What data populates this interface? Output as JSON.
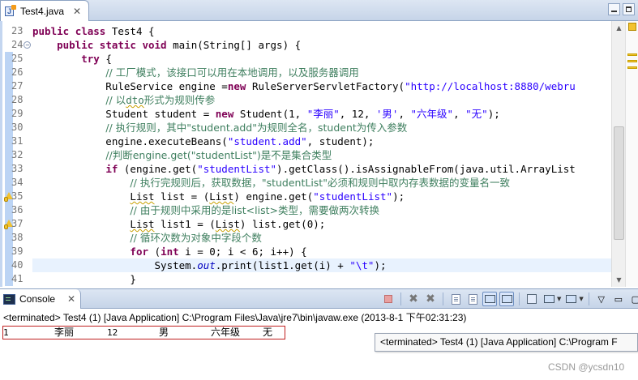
{
  "editor_tab": {
    "title": "Test4.java",
    "close": "✕"
  },
  "code_lines": [
    {
      "n": "23",
      "tokens": [
        {
          "t": "public ",
          "c": "kw"
        },
        {
          "t": "class ",
          "c": "kw"
        },
        {
          "t": "Test4 {"
        }
      ]
    },
    {
      "n": "24",
      "fold": "−",
      "tokens": [
        {
          "t": "    "
        },
        {
          "t": "public ",
          "c": "kw"
        },
        {
          "t": "static ",
          "c": "kw"
        },
        {
          "t": "void ",
          "c": "kw"
        },
        {
          "t": "main(String[] args) {"
        }
      ]
    },
    {
      "n": "25",
      "tokens": [
        {
          "t": "        "
        },
        {
          "t": "try ",
          "c": "kw"
        },
        {
          "t": "{"
        }
      ]
    },
    {
      "n": "26",
      "tokens": [
        {
          "t": "            "
        },
        {
          "t": "// 工厂模式，该接口可以用在本地调用，以及服务器调用",
          "c": "cm cjk"
        }
      ]
    },
    {
      "n": "27",
      "tokens": [
        {
          "t": "            RuleService engine ="
        },
        {
          "t": "new ",
          "c": "kw"
        },
        {
          "t": "RuleServerServletFactory("
        },
        {
          "t": "\"http://localhost:8880/webru",
          "c": "str"
        }
      ]
    },
    {
      "n": "28",
      "tokens": [
        {
          "t": "            "
        },
        {
          "t": "// 以",
          "c": "cm cjk"
        },
        {
          "t": "dto",
          "c": "cm squig"
        },
        {
          "t": "形式为规则传参",
          "c": "cm cjk"
        }
      ]
    },
    {
      "n": "29",
      "tokens": [
        {
          "t": "            Student student = "
        },
        {
          "t": "new ",
          "c": "kw"
        },
        {
          "t": "Student(1, "
        },
        {
          "t": "\"李丽\"",
          "c": "str"
        },
        {
          "t": ", 12, "
        },
        {
          "t": "'男'",
          "c": "str"
        },
        {
          "t": ", "
        },
        {
          "t": "\"六年级\"",
          "c": "str"
        },
        {
          "t": ", "
        },
        {
          "t": "\"无\"",
          "c": "str"
        },
        {
          "t": ");"
        }
      ]
    },
    {
      "n": "30",
      "tokens": [
        {
          "t": "            "
        },
        {
          "t": "// 执行规则，其中\"student.add\"为规则全名，student为传入参数",
          "c": "cm cjk"
        }
      ]
    },
    {
      "n": "31",
      "tokens": [
        {
          "t": "            engine.executeBeans("
        },
        {
          "t": "\"student.add\"",
          "c": "str"
        },
        {
          "t": ", student);"
        }
      ]
    },
    {
      "n": "32",
      "tokens": [
        {
          "t": "            "
        },
        {
          "t": "//判断engine.get(\"studentList\")是不是集合类型",
          "c": "cm cjk"
        }
      ]
    },
    {
      "n": "33",
      "tokens": [
        {
          "t": "            "
        },
        {
          "t": "if ",
          "c": "kw"
        },
        {
          "t": "(engine.get("
        },
        {
          "t": "\"studentList\"",
          "c": "str"
        },
        {
          "t": ").getClass().isAssignableFrom(java.util.ArrayList"
        }
      ]
    },
    {
      "n": "34",
      "tokens": [
        {
          "t": "                "
        },
        {
          "t": "// 执行完规则后，获取数据，\"studentList\"必须和规则中取内存表数据的变量名一致",
          "c": "cm cjk"
        }
      ]
    },
    {
      "n": "35",
      "warn": true,
      "tokens": [
        {
          "t": "                "
        },
        {
          "t": "List",
          "c": "squig"
        },
        {
          "t": " list = ("
        },
        {
          "t": "List",
          "c": "squig"
        },
        {
          "t": ") engine.get("
        },
        {
          "t": "\"studentList\"",
          "c": "str"
        },
        {
          "t": ");"
        }
      ]
    },
    {
      "n": "36",
      "tokens": [
        {
          "t": "                "
        },
        {
          "t": "// 由于规则中采用的是list<list>类型，需要做两次转换",
          "c": "cm cjk"
        }
      ]
    },
    {
      "n": "37",
      "warn": true,
      "tokens": [
        {
          "t": "                "
        },
        {
          "t": "List",
          "c": "squig"
        },
        {
          "t": " list1 = ("
        },
        {
          "t": "List",
          "c": "squig"
        },
        {
          "t": ") list.get(0);"
        }
      ]
    },
    {
      "n": "38",
      "tokens": [
        {
          "t": "                "
        },
        {
          "t": "// 循环次数为对象中字段个数",
          "c": "cm cjk"
        }
      ]
    },
    {
      "n": "39",
      "tokens": [
        {
          "t": "                "
        },
        {
          "t": "for ",
          "c": "kw"
        },
        {
          "t": "("
        },
        {
          "t": "int ",
          "c": "kw"
        },
        {
          "t": "i = 0; i < 6; i++) {"
        }
      ]
    },
    {
      "n": "40",
      "current": true,
      "tokens": [
        {
          "t": "                    System."
        },
        {
          "t": "out",
          "c": "fld"
        },
        {
          "t": ".print(list1.get(i) + "
        },
        {
          "t": "\"\\t\"",
          "c": "str"
        },
        {
          "t": ");"
        }
      ]
    },
    {
      "n": "41",
      "tokens": [
        {
          "t": "                }"
        }
      ]
    }
  ],
  "console": {
    "tab_label": "Console",
    "close": "✕",
    "status": "<terminated> Test4 (1) [Java Application] C:\\Program Files\\Java\\jre7\\bin\\javaw.exe (2013-8-1 下午02:31:23)",
    "output": [
      "1",
      "李丽",
      "12",
      "男",
      "六年级",
      "无"
    ],
    "tooltip": "<terminated> Test4 (1) [Java Application] C:\\Program F"
  },
  "watermark": "CSDN @ycsdn10",
  "colors": {
    "keyword": "#7f0055",
    "string": "#2a00ff",
    "comment": "#3f7f5f",
    "field": "#0000c0",
    "current_line": "#e8f2fe"
  }
}
